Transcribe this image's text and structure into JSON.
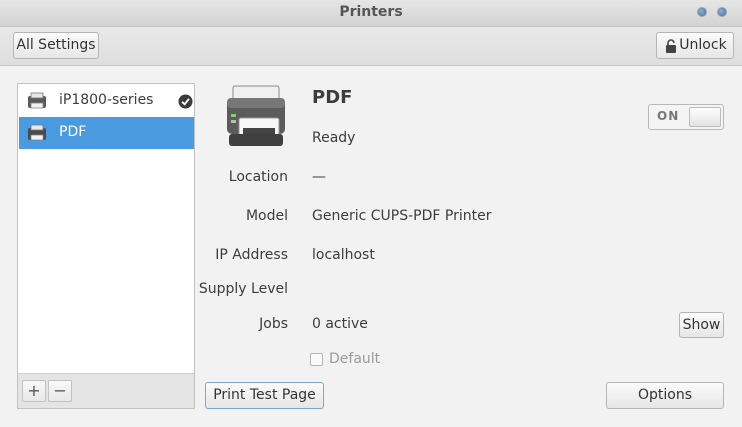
{
  "window": {
    "title": "Printers"
  },
  "toolbar": {
    "all_settings_label": "All Settings",
    "unlock_label": "Unlock"
  },
  "sidebar": {
    "items": [
      {
        "label": "iP1800-series",
        "selected": false,
        "is_default": true
      },
      {
        "label": "PDF",
        "selected": true,
        "is_default": false
      }
    ],
    "add_label": "+",
    "remove_label": "−"
  },
  "details": {
    "name": "PDF",
    "state": "Ready",
    "switch_label": "ON",
    "location_key": "Location",
    "location_value": "—",
    "model_key": "Model",
    "model_value": "Generic CUPS-PDF Printer",
    "ip_key": "IP Address",
    "ip_value": "localhost",
    "supply_key": "Supply Level",
    "jobs_key": "Jobs",
    "jobs_value": "0 active",
    "show_label": "Show",
    "default_label": "Default",
    "default_checked": false,
    "print_test_label": "Print Test Page",
    "options_label": "Options"
  },
  "colors": {
    "selection": "#4a9ae0",
    "window_bg": "#f2f2f2"
  }
}
